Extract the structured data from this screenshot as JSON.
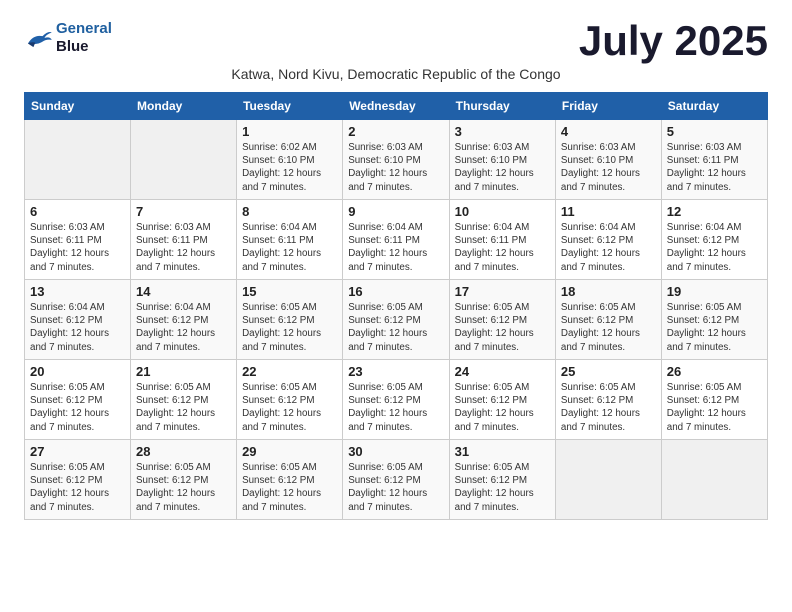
{
  "logo": {
    "line1": "General",
    "line2": "Blue"
  },
  "title": "July 2025",
  "location": "Katwa, Nord Kivu, Democratic Republic of the Congo",
  "days_header": [
    "Sunday",
    "Monday",
    "Tuesday",
    "Wednesday",
    "Thursday",
    "Friday",
    "Saturday"
  ],
  "weeks": [
    [
      {
        "day": "",
        "info": ""
      },
      {
        "day": "",
        "info": ""
      },
      {
        "day": "1",
        "info": "Sunrise: 6:02 AM\nSunset: 6:10 PM\nDaylight: 12 hours and 7 minutes."
      },
      {
        "day": "2",
        "info": "Sunrise: 6:03 AM\nSunset: 6:10 PM\nDaylight: 12 hours and 7 minutes."
      },
      {
        "day": "3",
        "info": "Sunrise: 6:03 AM\nSunset: 6:10 PM\nDaylight: 12 hours and 7 minutes."
      },
      {
        "day": "4",
        "info": "Sunrise: 6:03 AM\nSunset: 6:10 PM\nDaylight: 12 hours and 7 minutes."
      },
      {
        "day": "5",
        "info": "Sunrise: 6:03 AM\nSunset: 6:11 PM\nDaylight: 12 hours and 7 minutes."
      }
    ],
    [
      {
        "day": "6",
        "info": "Sunrise: 6:03 AM\nSunset: 6:11 PM\nDaylight: 12 hours and 7 minutes."
      },
      {
        "day": "7",
        "info": "Sunrise: 6:03 AM\nSunset: 6:11 PM\nDaylight: 12 hours and 7 minutes."
      },
      {
        "day": "8",
        "info": "Sunrise: 6:04 AM\nSunset: 6:11 PM\nDaylight: 12 hours and 7 minutes."
      },
      {
        "day": "9",
        "info": "Sunrise: 6:04 AM\nSunset: 6:11 PM\nDaylight: 12 hours and 7 minutes."
      },
      {
        "day": "10",
        "info": "Sunrise: 6:04 AM\nSunset: 6:11 PM\nDaylight: 12 hours and 7 minutes."
      },
      {
        "day": "11",
        "info": "Sunrise: 6:04 AM\nSunset: 6:12 PM\nDaylight: 12 hours and 7 minutes."
      },
      {
        "day": "12",
        "info": "Sunrise: 6:04 AM\nSunset: 6:12 PM\nDaylight: 12 hours and 7 minutes."
      }
    ],
    [
      {
        "day": "13",
        "info": "Sunrise: 6:04 AM\nSunset: 6:12 PM\nDaylight: 12 hours and 7 minutes."
      },
      {
        "day": "14",
        "info": "Sunrise: 6:04 AM\nSunset: 6:12 PM\nDaylight: 12 hours and 7 minutes."
      },
      {
        "day": "15",
        "info": "Sunrise: 6:05 AM\nSunset: 6:12 PM\nDaylight: 12 hours and 7 minutes."
      },
      {
        "day": "16",
        "info": "Sunrise: 6:05 AM\nSunset: 6:12 PM\nDaylight: 12 hours and 7 minutes."
      },
      {
        "day": "17",
        "info": "Sunrise: 6:05 AM\nSunset: 6:12 PM\nDaylight: 12 hours and 7 minutes."
      },
      {
        "day": "18",
        "info": "Sunrise: 6:05 AM\nSunset: 6:12 PM\nDaylight: 12 hours and 7 minutes."
      },
      {
        "day": "19",
        "info": "Sunrise: 6:05 AM\nSunset: 6:12 PM\nDaylight: 12 hours and 7 minutes."
      }
    ],
    [
      {
        "day": "20",
        "info": "Sunrise: 6:05 AM\nSunset: 6:12 PM\nDaylight: 12 hours and 7 minutes."
      },
      {
        "day": "21",
        "info": "Sunrise: 6:05 AM\nSunset: 6:12 PM\nDaylight: 12 hours and 7 minutes."
      },
      {
        "day": "22",
        "info": "Sunrise: 6:05 AM\nSunset: 6:12 PM\nDaylight: 12 hours and 7 minutes."
      },
      {
        "day": "23",
        "info": "Sunrise: 6:05 AM\nSunset: 6:12 PM\nDaylight: 12 hours and 7 minutes."
      },
      {
        "day": "24",
        "info": "Sunrise: 6:05 AM\nSunset: 6:12 PM\nDaylight: 12 hours and 7 minutes."
      },
      {
        "day": "25",
        "info": "Sunrise: 6:05 AM\nSunset: 6:12 PM\nDaylight: 12 hours and 7 minutes."
      },
      {
        "day": "26",
        "info": "Sunrise: 6:05 AM\nSunset: 6:12 PM\nDaylight: 12 hours and 7 minutes."
      }
    ],
    [
      {
        "day": "27",
        "info": "Sunrise: 6:05 AM\nSunset: 6:12 PM\nDaylight: 12 hours and 7 minutes."
      },
      {
        "day": "28",
        "info": "Sunrise: 6:05 AM\nSunset: 6:12 PM\nDaylight: 12 hours and 7 minutes."
      },
      {
        "day": "29",
        "info": "Sunrise: 6:05 AM\nSunset: 6:12 PM\nDaylight: 12 hours and 7 minutes."
      },
      {
        "day": "30",
        "info": "Sunrise: 6:05 AM\nSunset: 6:12 PM\nDaylight: 12 hours and 7 minutes."
      },
      {
        "day": "31",
        "info": "Sunrise: 6:05 AM\nSunset: 6:12 PM\nDaylight: 12 hours and 7 minutes."
      },
      {
        "day": "",
        "info": ""
      },
      {
        "day": "",
        "info": ""
      }
    ]
  ]
}
